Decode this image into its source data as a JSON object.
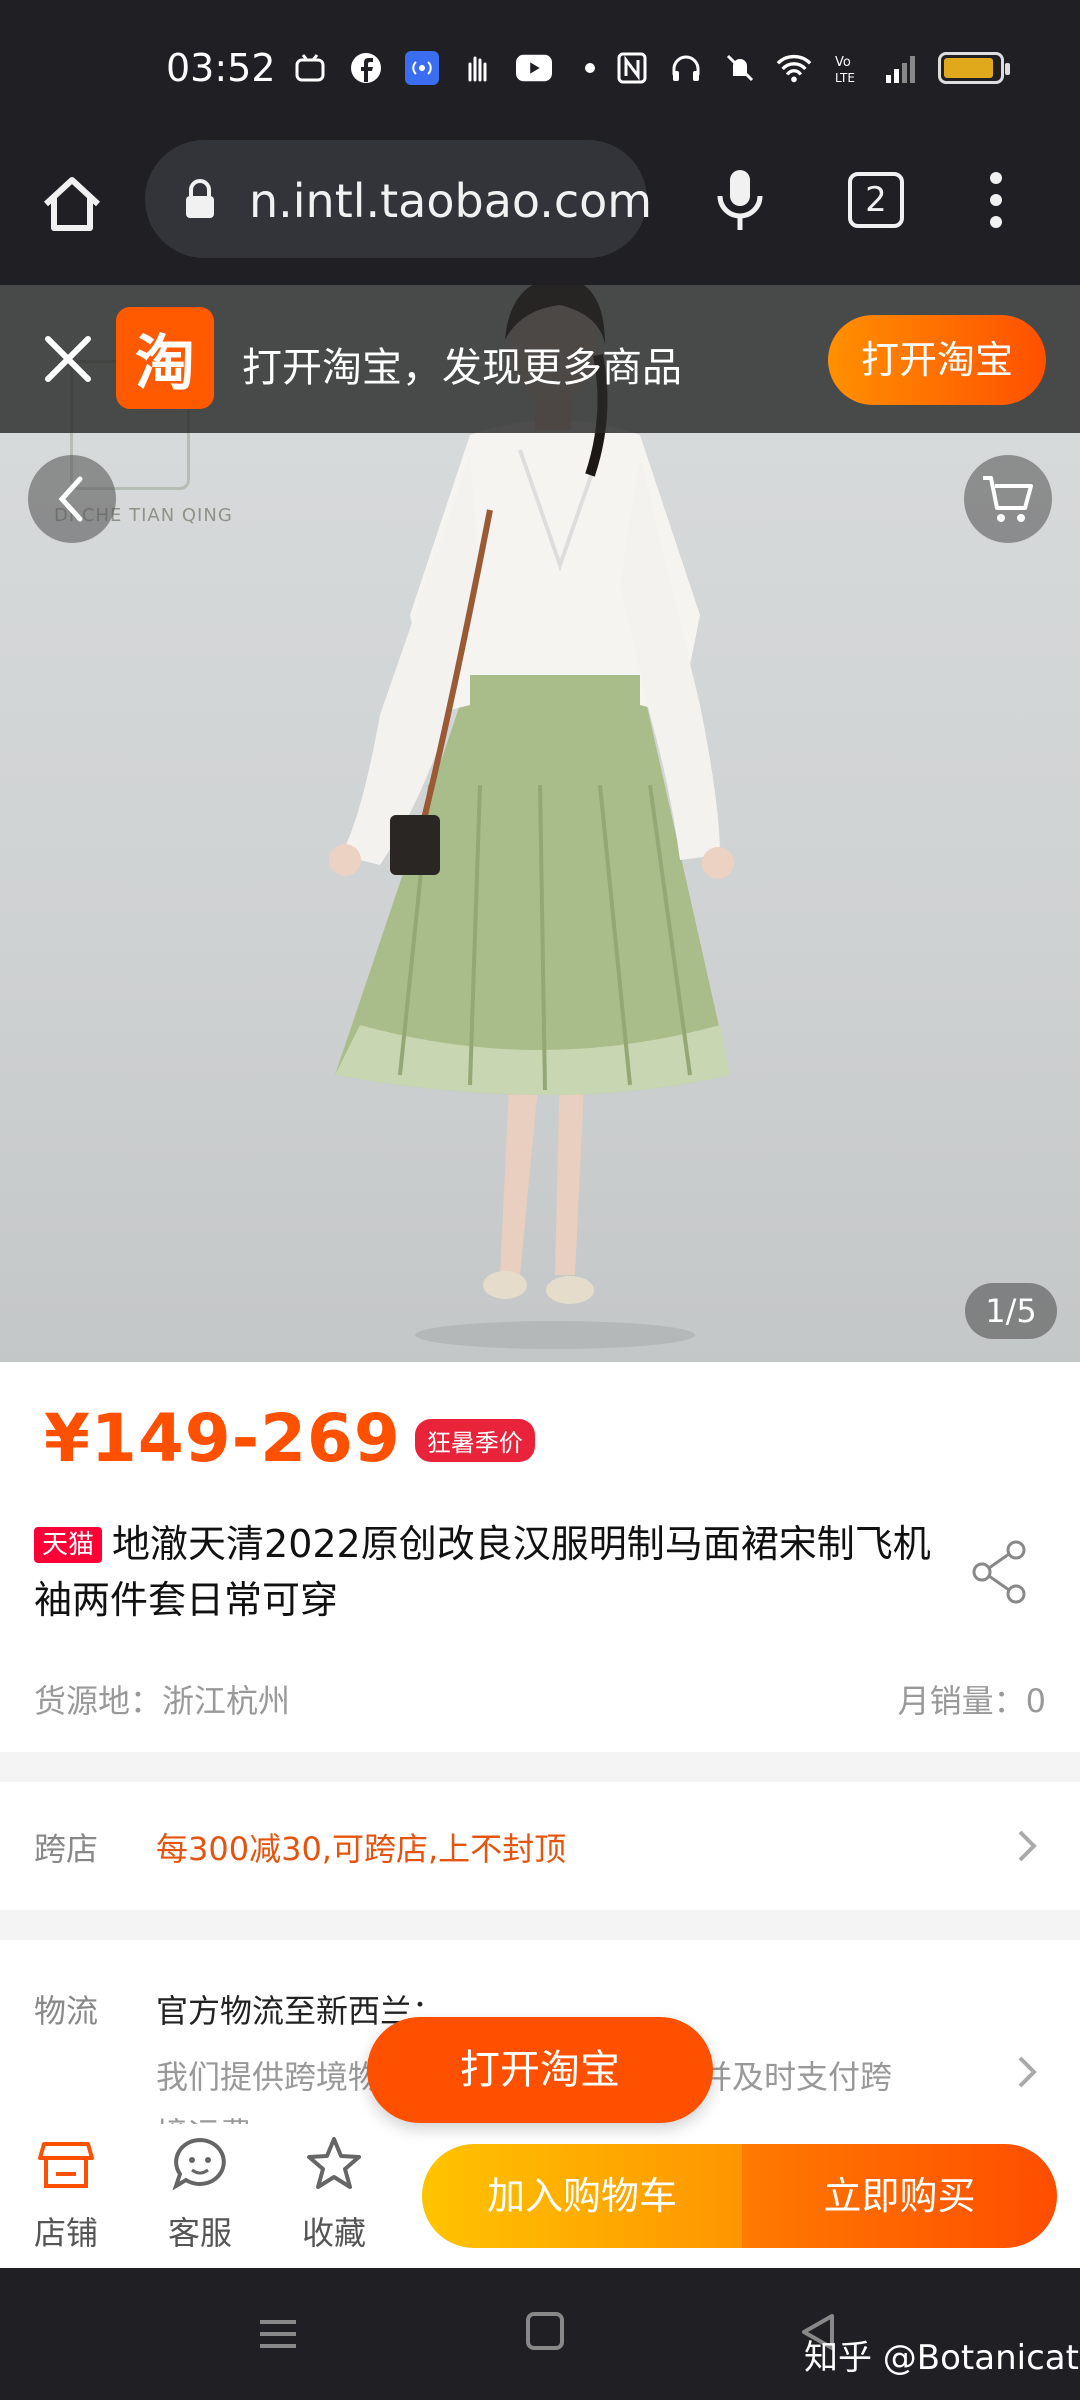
{
  "status_bar": {
    "time": "03:52",
    "battery_level": 0.9
  },
  "browser": {
    "url": "n.intl.taobao.com",
    "tab_count": "2"
  },
  "promo_banner": {
    "logo_char": "淘",
    "text": "打开淘宝，发现更多商品",
    "button": "打开淘宝"
  },
  "gallery": {
    "counter": "1/5"
  },
  "product": {
    "price": "¥149-269",
    "price_badge": "狂暑季价",
    "tmall_tag": "天猫",
    "title": "地澈天清2022原创改良汉服明制马面裙宋制飞机袖两件套日常可穿",
    "origin": "货源地：浙江杭州",
    "monthly_sales": "月销量：0"
  },
  "promotion": {
    "label": "跨店",
    "value": "每300减30,可跨店,上不封顶"
  },
  "logistics": {
    "label": "物流",
    "line1": "官方物流至新西兰：",
    "line2": "我们提供跨境物流服务，实时跟踪进度并及时支付跨",
    "line3": "境运费"
  },
  "floating_button": "打开淘宝",
  "action_bar": {
    "shop": "店铺",
    "service": "客服",
    "favorite": "收藏",
    "add_to_cart": "加入购物车",
    "buy_now": "立即购买"
  },
  "watermark_overlay": "知乎 @Botanicat",
  "colors": {
    "accent": "#ff5000",
    "chrome_bg": "#1f1f24"
  }
}
